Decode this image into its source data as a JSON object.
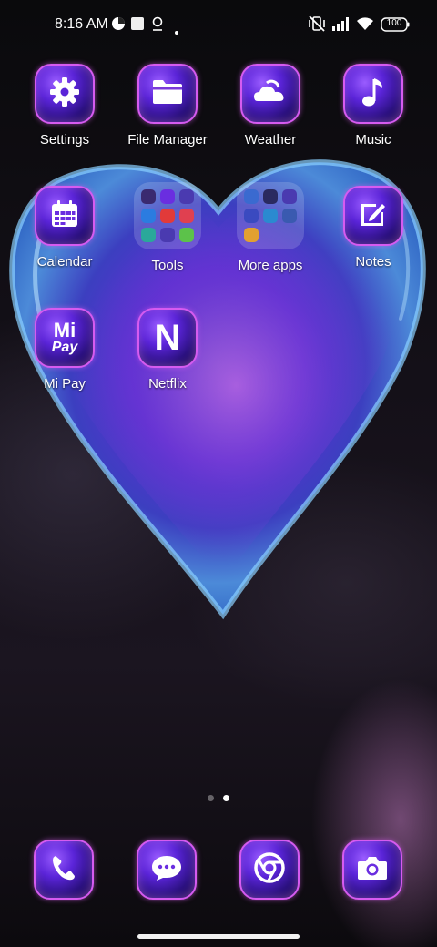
{
  "status_bar": {
    "time": "8:16 AM",
    "battery": "100"
  },
  "apps": [
    {
      "label": "Settings",
      "icon": "gear-icon"
    },
    {
      "label": "File Manager",
      "icon": "folder-icon"
    },
    {
      "label": "Weather",
      "icon": "cloud-icon"
    },
    {
      "label": "Music",
      "icon": "music-note-icon"
    },
    {
      "label": "Calendar",
      "icon": "calendar-icon"
    },
    {
      "label": "Tools",
      "icon": "folder-grid-icon"
    },
    {
      "label": "More apps",
      "icon": "folder-grid-icon"
    },
    {
      "label": "Notes",
      "icon": "pencil-icon"
    },
    {
      "label": "Mi Pay",
      "icon": "mi-pay-icon",
      "icon_text_top": "Mi",
      "icon_text_bottom": "Pay"
    },
    {
      "label": "Netflix",
      "icon": "netflix-icon",
      "icon_text": "N"
    }
  ],
  "dock": [
    {
      "name": "Phone",
      "icon": "phone-icon"
    },
    {
      "name": "Messages",
      "icon": "chat-icon"
    },
    {
      "name": "Chrome",
      "icon": "chrome-icon"
    },
    {
      "name": "Camera",
      "icon": "camera-icon"
    }
  ],
  "page_indicator": {
    "pages": 2,
    "current": 2
  },
  "colors": {
    "icon_border": "#d65bf0",
    "icon_gradient_start": "#9a5cff",
    "icon_gradient_end": "#1a0a4a",
    "glyph": "#ffffff"
  }
}
